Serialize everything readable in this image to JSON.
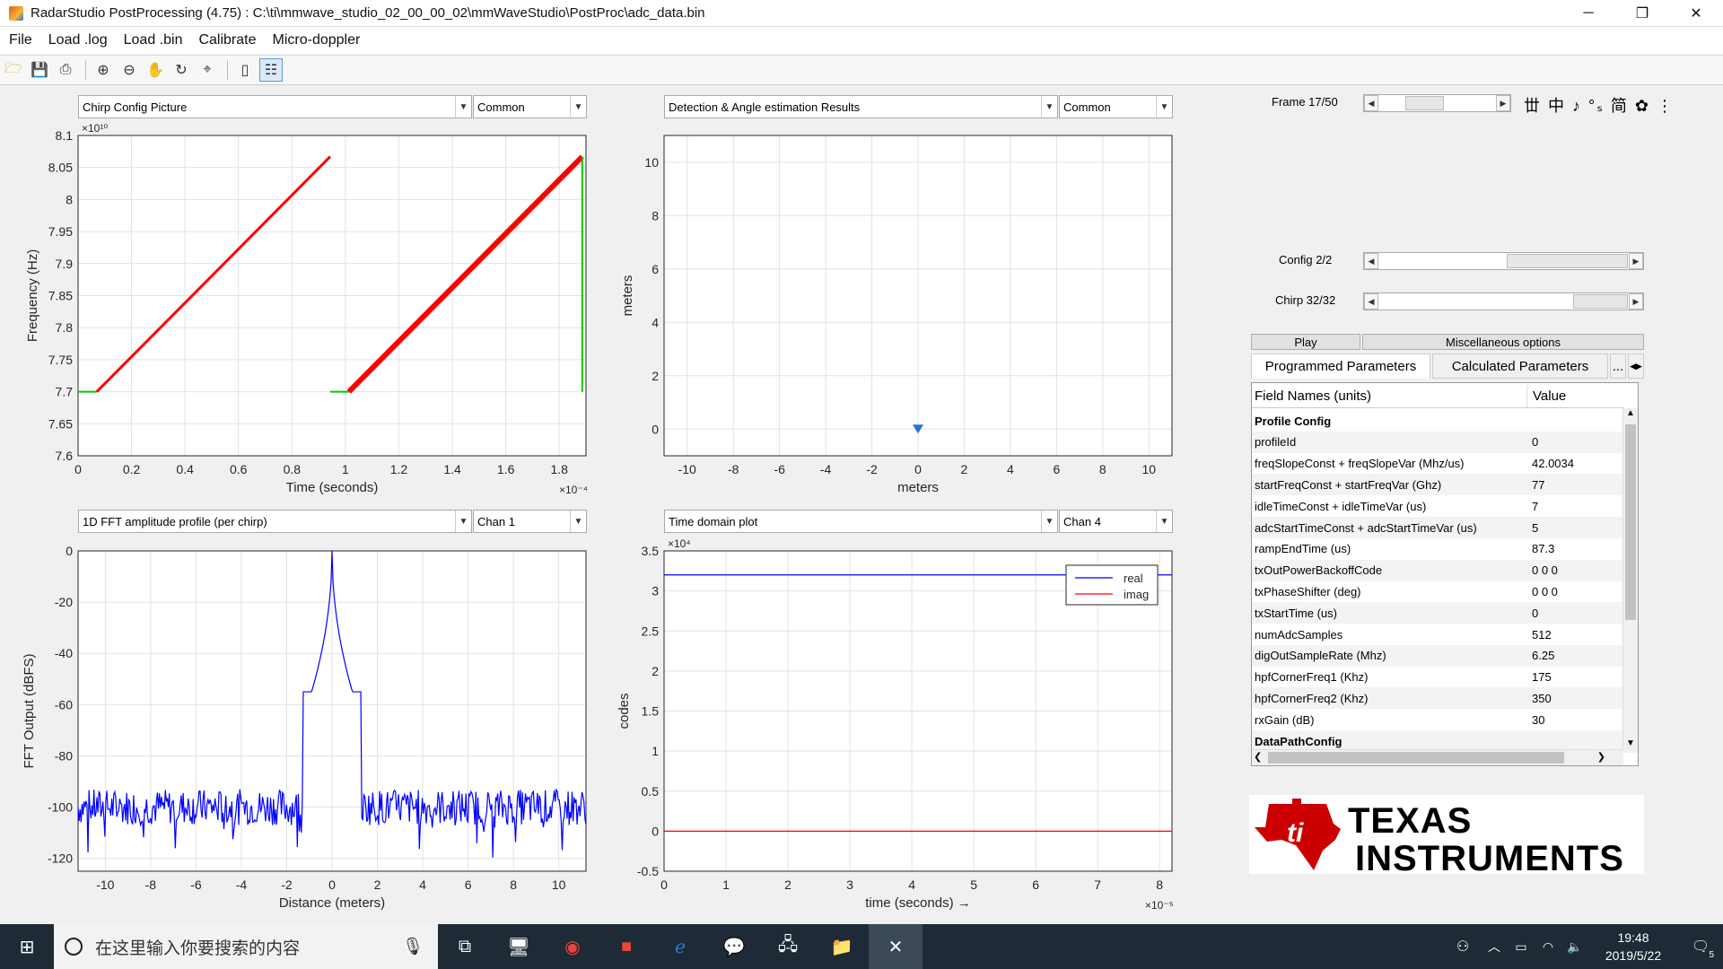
{
  "window": {
    "title": "RadarStudio PostProcessing (4.75)  : C:\\ti\\mmwave_studio_02_00_00_02\\mmWaveStudio\\PostProc\\adc_data.bin",
    "minimize": "─",
    "restore": "❐",
    "close": "✕"
  },
  "menu": [
    "File",
    "Load .log",
    "Load .bin",
    "Calibrate",
    "Micro-doppler"
  ],
  "toolbar": [
    "open-icon",
    "save-icon",
    "print-icon",
    "zoom-in-icon",
    "zoom-out-icon",
    "pan-icon",
    "rotate-icon",
    "data-cursor-icon",
    "colorbar-icon",
    "legend-icon"
  ],
  "panels": {
    "p1": {
      "select": "Chirp Config Picture",
      "mode": "Common"
    },
    "p2": {
      "select": "Detection & Angle estimation Results",
      "mode": "Common"
    },
    "p3": {
      "select": "1D FFT amplitude profile (per chirp)",
      "mode": "Chan 1"
    },
    "p4": {
      "select": "Time domain plot",
      "mode": "Chan 4"
    }
  },
  "controls": {
    "frame_label": "Frame 17/50",
    "frame_value": 0.34,
    "config_label": "Config 2/2",
    "config_value": 1.0,
    "chirp_label": "Chirp 32/32",
    "chirp_value": 1.0,
    "frame_toolbar_icons": "丗 中 ♪ °ₛ 简 ✿ ⋮",
    "play": "Play",
    "misc": "Miscellaneous options"
  },
  "tabs": {
    "programmed": "Programmed Parameters",
    "calculated": "Calculated Parameters",
    "more": "..."
  },
  "table": {
    "header_field": "Field Names    (units)",
    "header_value": "Value",
    "rows": [
      {
        "f": "Profile Config",
        "v": "",
        "section": true
      },
      {
        "f": "profileId",
        "v": "0"
      },
      {
        "f": "freqSlopeConst + freqSlopeVar (Mhz/us)",
        "v": "42.0034"
      },
      {
        "f": "startFreqConst + startFreqVar (Ghz)",
        "v": "77"
      },
      {
        "f": "idleTimeConst + idleTimeVar (us)",
        "v": "7"
      },
      {
        "f": "adcStartTimeConst + adcStartTimeVar (us)",
        "v": "5"
      },
      {
        "f": "rampEndTime (us)",
        "v": "87.3"
      },
      {
        "f": "txOutPowerBackoffCode",
        "v": "0 0 0"
      },
      {
        "f": "txPhaseShifter (deg)",
        "v": "0 0 0"
      },
      {
        "f": "txStartTime (us)",
        "v": "0"
      },
      {
        "f": "numAdcSamples",
        "v": "512"
      },
      {
        "f": "digOutSampleRate (Mhz)",
        "v": "6.25"
      },
      {
        "f": "hpfCornerFreq1 (Khz)",
        "v": "175"
      },
      {
        "f": "hpfCornerFreq2 (Khz)",
        "v": "350"
      },
      {
        "f": "rxGain (dB)",
        "v": "30"
      },
      {
        "f": "DataPathConfig",
        "v": "",
        "section": true
      }
    ]
  },
  "logo": {
    "line1": "TEXAS",
    "line2": "INSTRUMENTS"
  },
  "taskbar": {
    "search_placeholder": "在这里输入你要搜索的内容",
    "time": "19:48",
    "date": "2019/5/22",
    "notif_count": "5"
  },
  "chart_data": [
    {
      "type": "line",
      "title": "",
      "xlabel": "Time (seconds)",
      "ylabel": "Frequency (Hz)",
      "x_exponent": "×10⁻⁴",
      "y_exponent": "×10¹⁰",
      "xlim": [
        0,
        1.9
      ],
      "ylim": [
        7.6,
        8.1
      ],
      "xticks": [
        "0",
        "0.2",
        "0.4",
        "0.6",
        "0.8",
        "1",
        "1.2",
        "1.4",
        "1.6",
        "1.8"
      ],
      "yticks": [
        "7.6",
        "7.65",
        "7.7",
        "7.75",
        "7.8",
        "7.85",
        "7.9",
        "7.95",
        "8",
        "8.05",
        "8.1"
      ],
      "series": [
        {
          "color": "#00cc00",
          "x": [
            0,
            0.07
          ],
          "y": [
            7.7,
            7.7
          ]
        },
        {
          "color": "#ff0000",
          "x": [
            0.07,
            0.943
          ],
          "y": [
            7.7,
            8.067
          ]
        },
        {
          "color": "#00cc00",
          "x": [
            0.943,
            1.013
          ],
          "y": [
            7.7,
            7.7
          ]
        },
        {
          "color": "#ff0000",
          "x": [
            1.013,
            1.886
          ],
          "y": [
            7.7,
            8.067
          ]
        },
        {
          "color": "#00cc00",
          "x": [
            1.886,
            1.886
          ],
          "y": [
            7.7,
            8.067
          ]
        }
      ]
    },
    {
      "type": "scatter",
      "xlabel": "meters",
      "ylabel": "meters",
      "xlim": [
        -11,
        11
      ],
      "ylim": [
        -1,
        11
      ],
      "xticks": [
        "-10",
        "-8",
        "-6",
        "-4",
        "-2",
        "0",
        "2",
        "4",
        "6",
        "8",
        "10"
      ],
      "yticks": [
        "0",
        "2",
        "4",
        "6",
        "8",
        "10"
      ],
      "points": [
        {
          "x": 0,
          "y": 0
        }
      ]
    },
    {
      "type": "line",
      "xlabel": "Distance (meters)",
      "ylabel": "FFT Output (dBFS)",
      "xlim": [
        -11.2,
        11.2
      ],
      "ylim": [
        -125,
        0
      ],
      "xticks": [
        "-10",
        "-8",
        "-6",
        "-4",
        "-2",
        "0",
        "2",
        "4",
        "6",
        "8",
        "10"
      ],
      "yticks": [
        "0",
        "-20",
        "-40",
        "-60",
        "-80",
        "-100",
        "-120"
      ],
      "noise_floor": -100,
      "peak_x": 0,
      "peak_y": 0
    },
    {
      "type": "line",
      "xlabel": "time  (seconds) →",
      "ylabel": "codes",
      "x_exponent": "×10⁻⁵",
      "y_exponent": "×10⁴",
      "xlim": [
        0,
        8.2
      ],
      "ylim": [
        -0.5,
        3.5
      ],
      "xticks": [
        "0",
        "1",
        "2",
        "3",
        "4",
        "5",
        "6",
        "7",
        "8"
      ],
      "yticks": [
        "-0.5",
        "0",
        "0.5",
        "1",
        "1.5",
        "2",
        "2.5",
        "3",
        "3.5"
      ],
      "series": [
        {
          "name": "real",
          "color": "#0000ff",
          "y": 3.2
        },
        {
          "name": "imag",
          "color": "#ff0000",
          "y": 0
        }
      ]
    }
  ]
}
